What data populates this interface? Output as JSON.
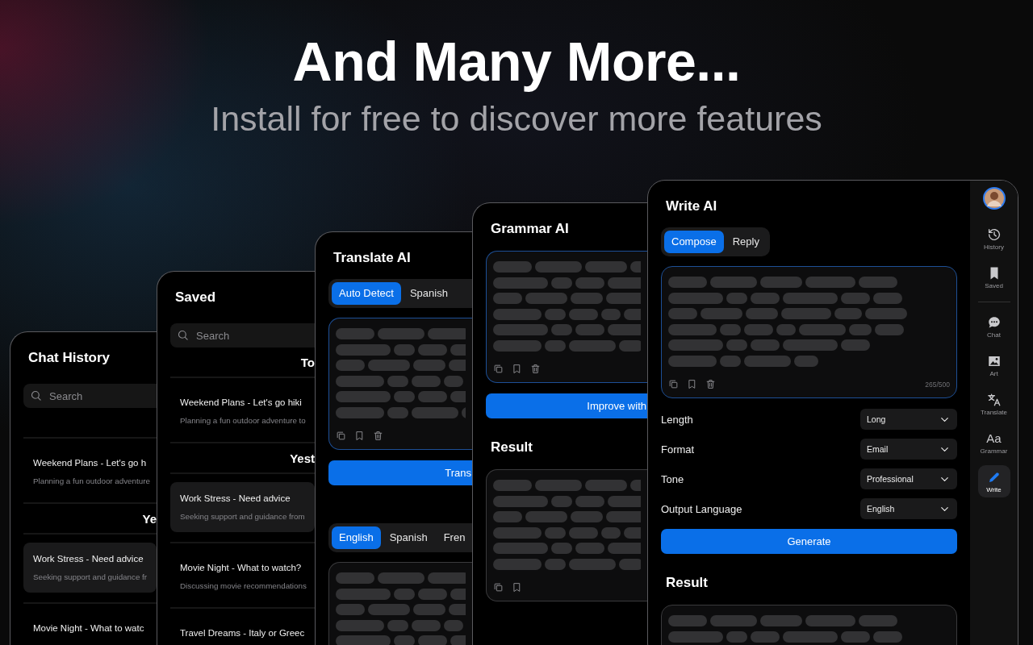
{
  "headline": {
    "title": "And Many More...",
    "subtitle": "Install for free to discover more features"
  },
  "windows": [
    {
      "kind": "list",
      "title": "Chat History",
      "search": {
        "placeholder": "Search"
      },
      "entries": [
        {
          "kind": "header"
        },
        {
          "kind": "item",
          "title": "Weekend Plans - Let's go h",
          "preview": "Planning a fun outdoor adventure",
          "selected": false
        },
        {
          "kind": "header",
          "label": "Ye"
        },
        {
          "kind": "item",
          "title": "Work Stress - Need advice",
          "preview": "Seeking support and guidance fr",
          "selected": true
        },
        {
          "kind": "item",
          "title": "Movie Night - What to watc",
          "selected": false
        }
      ]
    },
    {
      "kind": "list",
      "title": "Saved",
      "search": {
        "placeholder": "Search"
      },
      "entries": [
        {
          "kind": "header",
          "label": "To"
        },
        {
          "kind": "item",
          "title": "Weekend Plans - Let's go hiki",
          "preview": "Planning a fun outdoor adventure to",
          "selected": false
        },
        {
          "kind": "header",
          "label": "Yest"
        },
        {
          "kind": "item",
          "title": "Work Stress - Need advice",
          "preview": "Seeking support and guidance from",
          "selected": true
        },
        {
          "kind": "item",
          "title": "Movie Night - What to watch?",
          "preview": "Discussing movie recommendations",
          "selected": false
        },
        {
          "kind": "item",
          "title": "Travel Dreams - Italy or Greec",
          "selected": false
        }
      ]
    },
    {
      "kind": "translate",
      "title": "Translate AI",
      "source_tabs": [
        {
          "label": "Auto Detect",
          "selected": true
        },
        {
          "label": "Spanish",
          "selected": false
        }
      ],
      "action": "Trans",
      "target_tabs": [
        {
          "label": "English",
          "selected": true
        },
        {
          "label": "Spanish",
          "selected": false
        },
        {
          "label": "Fren",
          "selected": false
        }
      ]
    },
    {
      "kind": "grammar",
      "title": "Grammar AI",
      "action": "Improve with",
      "result_title": "Result"
    },
    {
      "kind": "write",
      "title": "Write AI",
      "tabs": [
        {
          "label": "Compose",
          "selected": true
        },
        {
          "label": "Reply",
          "selected": false
        }
      ],
      "counter": "265/500",
      "settings": [
        {
          "label": "Length",
          "value": "Long"
        },
        {
          "label": "Format",
          "value": "Email"
        },
        {
          "label": "Tone",
          "value": "Professional"
        },
        {
          "label": "Output Language",
          "value": "English"
        }
      ],
      "action": "Generate",
      "result_title": "Result",
      "sidebar": [
        {
          "label": "History",
          "selected": false
        },
        {
          "label": "Saved",
          "selected": false
        },
        {
          "label": "Chat",
          "selected": false
        },
        {
          "label": "Art",
          "selected": false
        },
        {
          "label": "Translate",
          "selected": false
        },
        {
          "label": "Grammar",
          "glyph": "Aa",
          "selected": false
        },
        {
          "label": "Write",
          "selected": true
        }
      ]
    }
  ]
}
